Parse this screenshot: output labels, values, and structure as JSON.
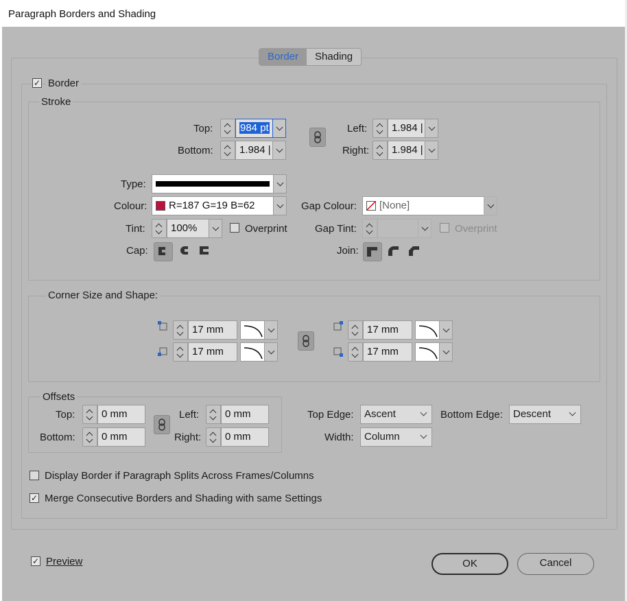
{
  "window": {
    "title": "Paragraph Borders and Shading"
  },
  "tabs": [
    {
      "label": "Border",
      "active": true
    },
    {
      "label": "Shading",
      "active": false
    }
  ],
  "border": {
    "checkbox_label": "Border",
    "checked": true,
    "stroke": {
      "legend": "Stroke",
      "top": {
        "label": "Top:",
        "value": "984 pt"
      },
      "bottom": {
        "label": "Bottom:",
        "value": "1.984 |"
      },
      "left": {
        "label": "Left:",
        "value": "1.984 |"
      },
      "right": {
        "label": "Right:",
        "value": "1.984 |"
      },
      "type": {
        "label": "Type:"
      },
      "colour": {
        "label": "Colour:",
        "value": "R=187 G=19 B=62",
        "swatch": "#bb133e"
      },
      "gap_colour": {
        "label": "Gap Colour:",
        "value": "[None]"
      },
      "tint": {
        "label": "Tint:",
        "value": "100%"
      },
      "overprint": {
        "label": "Overprint",
        "checked": false
      },
      "gap_tint": {
        "label": "Gap Tint:"
      },
      "gap_overprint": {
        "label": "Overprint",
        "checked": false
      },
      "cap": {
        "label": "Cap:",
        "options": [
          "butt-cap-icon",
          "round-cap-icon",
          "projecting-cap-icon"
        ],
        "selected": 0
      },
      "join": {
        "label": "Join:",
        "options": [
          "miter-join-icon",
          "round-join-icon",
          "bevel-join-icon"
        ],
        "selected": 0
      }
    },
    "corners": {
      "legend": "Corner Size and Shape:",
      "top_left": "17 mm",
      "bottom_left": "17 mm",
      "top_right": "17 mm",
      "bottom_right": "17 mm"
    },
    "offsets": {
      "legend": "Offsets",
      "top": {
        "label": "Top:",
        "value": "0 mm"
      },
      "bottom": {
        "label": "Bottom:",
        "value": "0 mm"
      },
      "left": {
        "label": "Left:",
        "value": "0 mm"
      },
      "right": {
        "label": "Right:",
        "value": "0 mm"
      }
    },
    "top_edge": {
      "label": "Top Edge:",
      "value": "Ascent"
    },
    "bottom_edge": {
      "label": "Bottom Edge:",
      "value": "Descent"
    },
    "width": {
      "label": "Width:",
      "value": "Column"
    },
    "display_split": {
      "label": "Display Border if Paragraph Splits Across Frames/Columns",
      "checked": false
    },
    "merge": {
      "label": "Merge Consecutive Borders and Shading with same Settings",
      "checked": true
    }
  },
  "preview": {
    "label": "Preview",
    "checked": true
  },
  "buttons": {
    "ok": "OK",
    "cancel": "Cancel"
  },
  "colors": {
    "accent": "#2c66c6",
    "selection": "#1e63d6"
  }
}
